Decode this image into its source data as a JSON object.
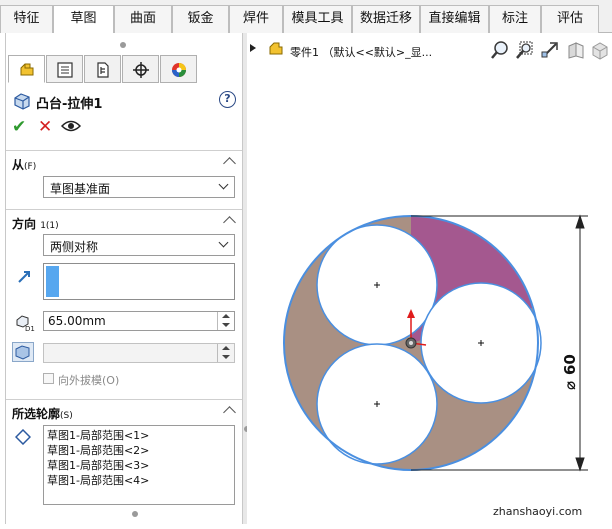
{
  "tabs": [
    {
      "label": "特征",
      "active": false
    },
    {
      "label": "草图",
      "active": true
    },
    {
      "label": "曲面",
      "active": false
    },
    {
      "label": "钣金",
      "active": false
    },
    {
      "label": "焊件",
      "active": false
    },
    {
      "label": "模具工具",
      "active": false
    },
    {
      "label": "数据迁移",
      "active": false
    },
    {
      "label": "直接编辑",
      "active": false
    },
    {
      "label": "标注",
      "active": false
    },
    {
      "label": "评估",
      "active": false
    }
  ],
  "panel_tabs": [
    {
      "icon": "feature-manager-icon",
      "active": true
    },
    {
      "icon": "property-manager-icon",
      "active": false
    },
    {
      "icon": "configuration-manager-icon",
      "active": false
    },
    {
      "icon": "dim-xpert-icon",
      "active": false
    },
    {
      "icon": "display-manager-icon",
      "active": false
    }
  ],
  "feature": {
    "title": "凸台-拉伸1",
    "help": "?",
    "ok": "✔",
    "cancel": "✕",
    "preview": "👁"
  },
  "from": {
    "header": "从",
    "header_key": "(F)",
    "value": "草图基准面"
  },
  "direction": {
    "header": "方向 ",
    "header_key": "1(1)",
    "end_condition": "两侧对称",
    "depth": "65.00mm",
    "draft": "",
    "draft_outward_label": "向外拔模(O)"
  },
  "contours": {
    "header": "所选轮廓",
    "header_key": "(S)",
    "items": [
      "草图1-局部范围<1>",
      "草图1-局部范围<2>",
      "草图1-局部范围<3>",
      "草图1-局部范围<4>"
    ]
  },
  "tree": {
    "node": "零件1 （默认<<默认>_显..."
  },
  "view_tools": [
    "zoom-to-fit-icon",
    "zoom-to-area-icon",
    "previous-view-icon",
    "section-view-icon",
    "view-orientation-icon"
  ],
  "drawing": {
    "dimension_label": "60",
    "diameter_symbol": "⌀",
    "fill_purple": "#a4588f",
    "fill_brown": "#a99083",
    "outline": "#4a8fe0"
  },
  "watermark": "zhanshaoyi.com"
}
